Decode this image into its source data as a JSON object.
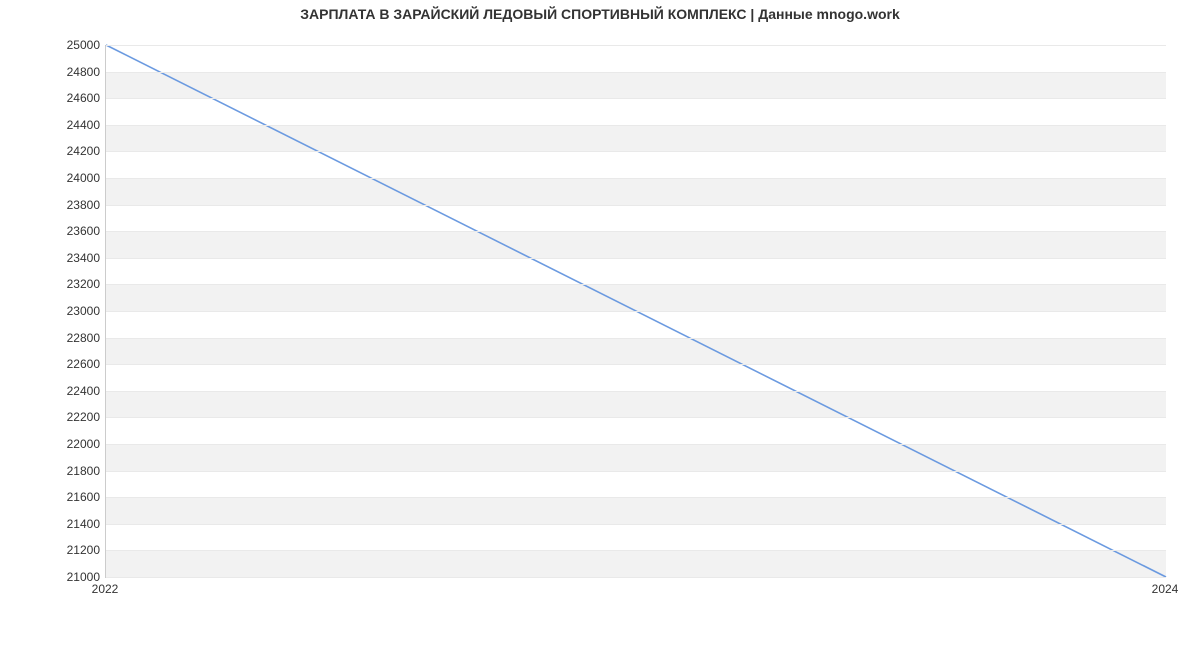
{
  "chart_data": {
    "type": "line",
    "title": "ЗАРПЛАТА В ЗАРАЙСКИЙ ЛЕДОВЫЙ СПОРТИВНЫЙ КОМПЛЕКС | Данные mnogo.work",
    "xlabel": "",
    "ylabel": "",
    "x": [
      2022,
      2024
    ],
    "values": [
      25000,
      21000
    ],
    "y_ticks": [
      21000,
      21200,
      21400,
      21600,
      21800,
      22000,
      22200,
      22400,
      22600,
      22800,
      23000,
      23200,
      23400,
      23600,
      23800,
      24000,
      24200,
      24400,
      24600,
      24800,
      25000
    ],
    "x_ticks": [
      2022,
      2024
    ],
    "ylim": [
      21000,
      25000
    ],
    "xlim": [
      2022,
      2024
    ],
    "line_color": "#6b9ae0",
    "grid": true
  }
}
